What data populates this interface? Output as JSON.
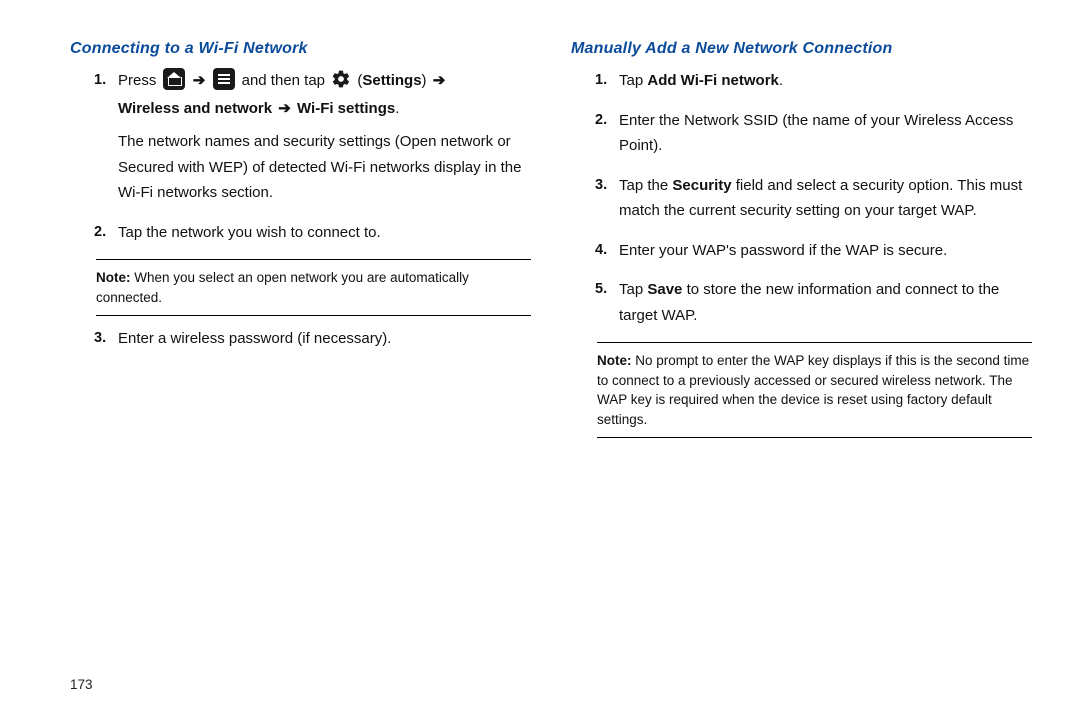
{
  "pageNumber": "173",
  "left": {
    "title": "Connecting to a Wi-Fi Network",
    "steps": [
      {
        "n": "1.",
        "pre": "Press ",
        "mid": " and then tap ",
        "settingsOpen": "  (",
        "settingsLabel": "Settings",
        "settingsClose": ") ",
        "line2a": "Wireless and network ",
        "line2b": " Wi-Fi settings",
        "period": ".",
        "desc": "The network names and security settings (Open network or Secured with WEP) of detected Wi-Fi networks display in the Wi-Fi networks section."
      },
      {
        "n": "2.",
        "text": "Tap the network you wish to connect to."
      },
      {
        "n": "3.",
        "text": "Enter a wireless password (if necessary)."
      }
    ],
    "note": "When you select an open network you are automatically connected.",
    "noteLabel": "Note: "
  },
  "right": {
    "title": "Manually Add a New Network Connection",
    "steps": [
      {
        "n": "1.",
        "pre": "Tap ",
        "bold": "Add Wi-Fi network",
        "post": "."
      },
      {
        "n": "2.",
        "text": "Enter the Network SSID (the name of your Wireless Access Point)."
      },
      {
        "n": "3.",
        "pre": "Tap the ",
        "bold": "Security",
        "post": " field and select a security option. This must match the current security setting on your target WAP."
      },
      {
        "n": "4.",
        "text": "Enter your WAP's password if the WAP is secure."
      },
      {
        "n": "5.",
        "pre": "Tap ",
        "bold": "Save",
        "post": " to store the new information and connect to the target WAP."
      }
    ],
    "noteLabel": "Note: ",
    "note": "No prompt to enter the WAP key displays if this is the second time to connect to a previously accessed or secured wireless network. The WAP key is required when the device is reset using factory default settings."
  },
  "arrow": "➔"
}
